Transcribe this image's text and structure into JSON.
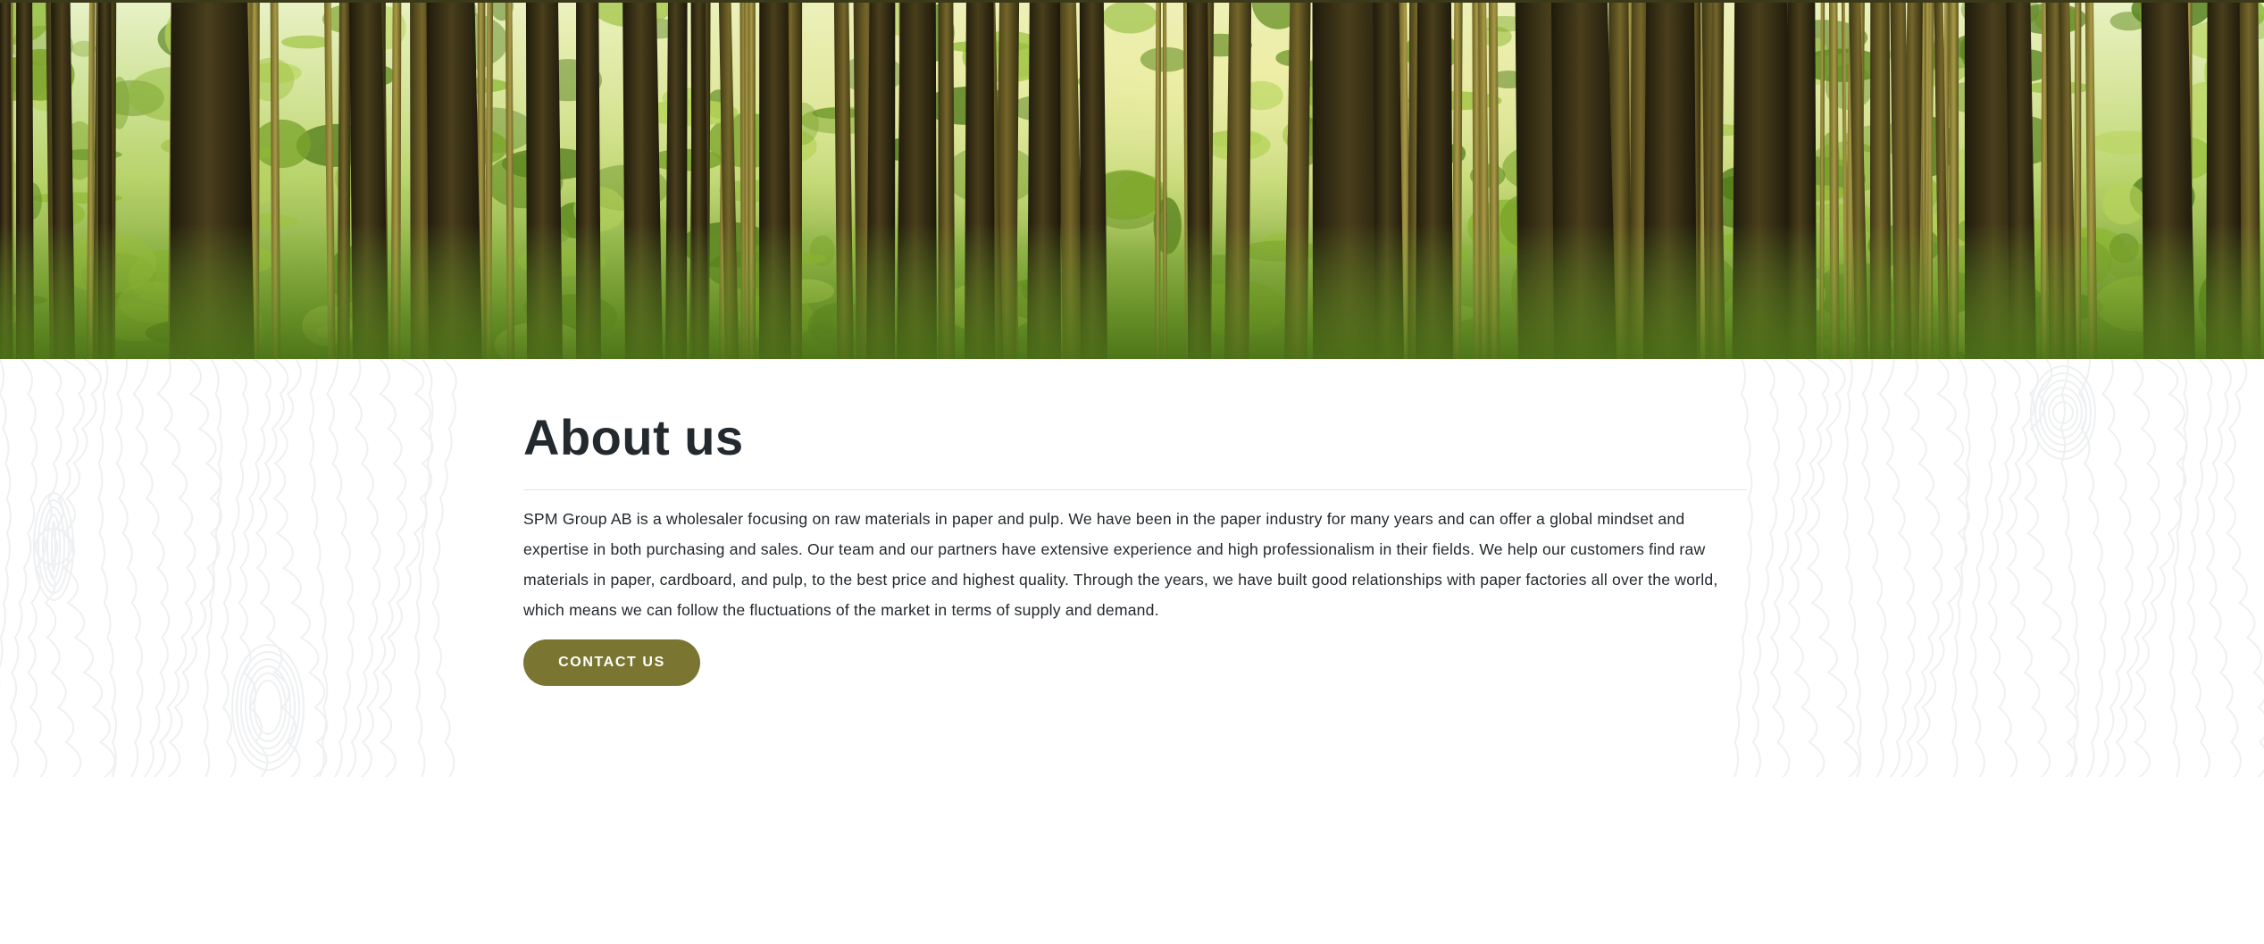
{
  "hero": {
    "image": "forest-banner"
  },
  "about": {
    "title": "About us",
    "body": "SPM Group AB is a wholesaler focusing on raw materials in paper and pulp. We have been in the paper industry for many years and can offer a global mindset and expertise in both purchasing and sales. Our team and our partners have extensive experience and high professionalism in their fields. We help our customers find raw materials in paper, cardboard, and pulp, to the best price and highest quality. Through the years, we have built good relationships with paper factories all over the world, which means we can follow the fluctuations of the market in terms of supply and demand.",
    "cta_label": "CONTACT US"
  },
  "colors": {
    "accent": "#7a7632",
    "heading": "#222a30",
    "text": "#22282c",
    "divider": "#e3e5e6",
    "woodgrain": "#eef0f2"
  }
}
